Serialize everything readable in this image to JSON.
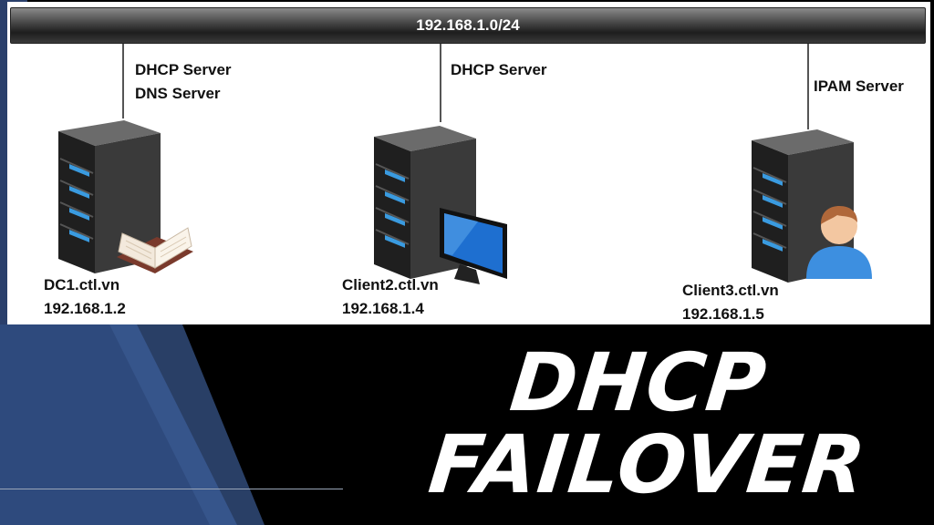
{
  "network": {
    "subnet": "192.168.1.0/24"
  },
  "servers": [
    {
      "roles": [
        "DHCP Server",
        "DNS Server"
      ],
      "hostname": "DC1.ctl.vn",
      "ip": "192.168.1.2",
      "badge": "book-icon"
    },
    {
      "roles": [
        "DHCP Server"
      ],
      "hostname": "Client2.ctl.vn",
      "ip": "192.168.1.4",
      "badge": "monitor-icon"
    },
    {
      "roles": [
        "IPAM Server"
      ],
      "hostname": "Client3.ctl.vn",
      "ip": "192.168.1.5",
      "badge": "user-icon"
    }
  ],
  "title": {
    "line1": "DHCP",
    "line2": "FAILOVER"
  },
  "colors": {
    "background": "#000000",
    "panel": "#ffffff",
    "accent_blue": "#2e4a7d",
    "server_led": "#3a9be0"
  }
}
